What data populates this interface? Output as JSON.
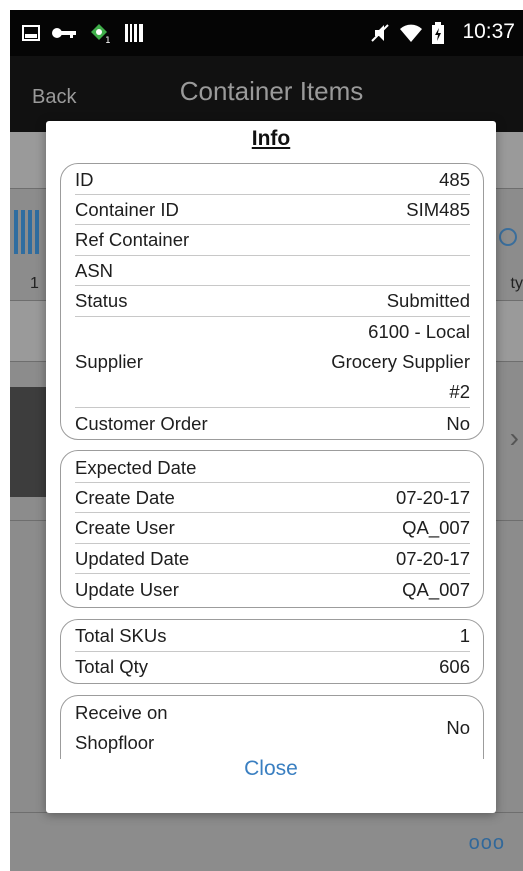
{
  "status_bar": {
    "time": "10:37",
    "icons": [
      "image-icon",
      "key-icon",
      "android-notify-icon",
      "barcode-icon",
      "mute-icon",
      "wifi-icon",
      "battery-icon"
    ]
  },
  "header": {
    "back_label": "Back",
    "title": "Container Items"
  },
  "background": {
    "count_label": "1",
    "qty_label_partial": "ty",
    "more_label": "ooo"
  },
  "dialog": {
    "title": "Info",
    "groups": [
      {
        "rows": [
          {
            "label": "ID",
            "value": "485"
          },
          {
            "label": "Container ID",
            "value": "SIM485"
          },
          {
            "label": "Ref Container",
            "value": ""
          },
          {
            "label": "ASN",
            "value": ""
          },
          {
            "label": "Status",
            "value": "Submitted"
          },
          {
            "label": "Supplier",
            "value_lines": [
              "6100 - Local",
              "Grocery Supplier",
              "#2"
            ]
          },
          {
            "label": "Customer Order",
            "value": "No"
          }
        ]
      },
      {
        "rows": [
          {
            "label": "Expected Date",
            "value": ""
          },
          {
            "label": "Create Date",
            "value": "07-20-17"
          },
          {
            "label": "Create User",
            "value": "QA_007"
          },
          {
            "label": "Updated Date",
            "value": "07-20-17"
          },
          {
            "label": "Update User",
            "value": "QA_007"
          }
        ]
      },
      {
        "rows": [
          {
            "label": "Total SKUs",
            "value": "1"
          },
          {
            "label": "Total Qty",
            "value": "606"
          }
        ]
      },
      {
        "rows": [
          {
            "label_lines": [
              "Receive on",
              "Shopfloor"
            ],
            "value": "No"
          }
        ]
      }
    ],
    "close_label": "Close"
  },
  "colors": {
    "accent": "#3a7fc1",
    "status_bar": "#050505",
    "header": "#111111",
    "dim_overlay": "#8c8c8c"
  }
}
